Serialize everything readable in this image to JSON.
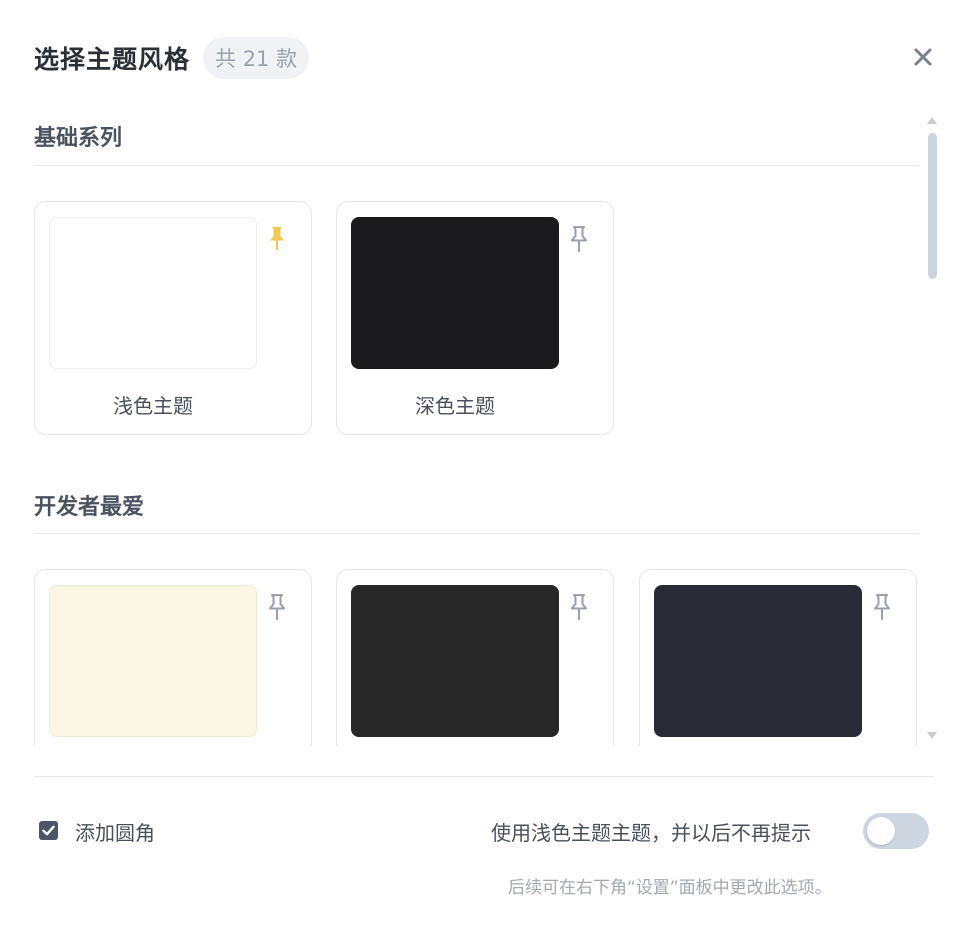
{
  "dialog": {
    "title": "选择主题风格",
    "count_badge": "共 21 款"
  },
  "icons": {
    "close": "close-icon",
    "pin": "pin-icon",
    "checkbox": "checkmark-icon"
  },
  "sections": [
    {
      "title": "基础系列",
      "cards": [
        {
          "label": "浅色主题",
          "preview_color": "#ffffff",
          "pinned": true
        },
        {
          "label": "深色主题",
          "preview_color": "#1b1b1d",
          "pinned": false
        }
      ]
    },
    {
      "title": "开发者最爱",
      "cards": [
        {
          "label": "",
          "preview_color": "#fcf7e5",
          "pinned": false
        },
        {
          "label": "",
          "preview_color": "#272727",
          "pinned": false
        },
        {
          "label": "",
          "preview_color": "#282b36",
          "pinned": false
        }
      ]
    }
  ],
  "footer": {
    "rounded_corners_label": "添加圆角",
    "rounded_corners_checked": true,
    "use_light_label": "使用浅色主题主题，并以后不再提示",
    "use_light_enabled": false,
    "hint": "后续可在右下角“设置”面板中更改此选项。"
  },
  "colors": {
    "pin_active": "#f2c94c",
    "pin_inactive": "#9aa1ad",
    "checkbox": "#4b5567",
    "toggle_off": "#cdd5e1"
  }
}
